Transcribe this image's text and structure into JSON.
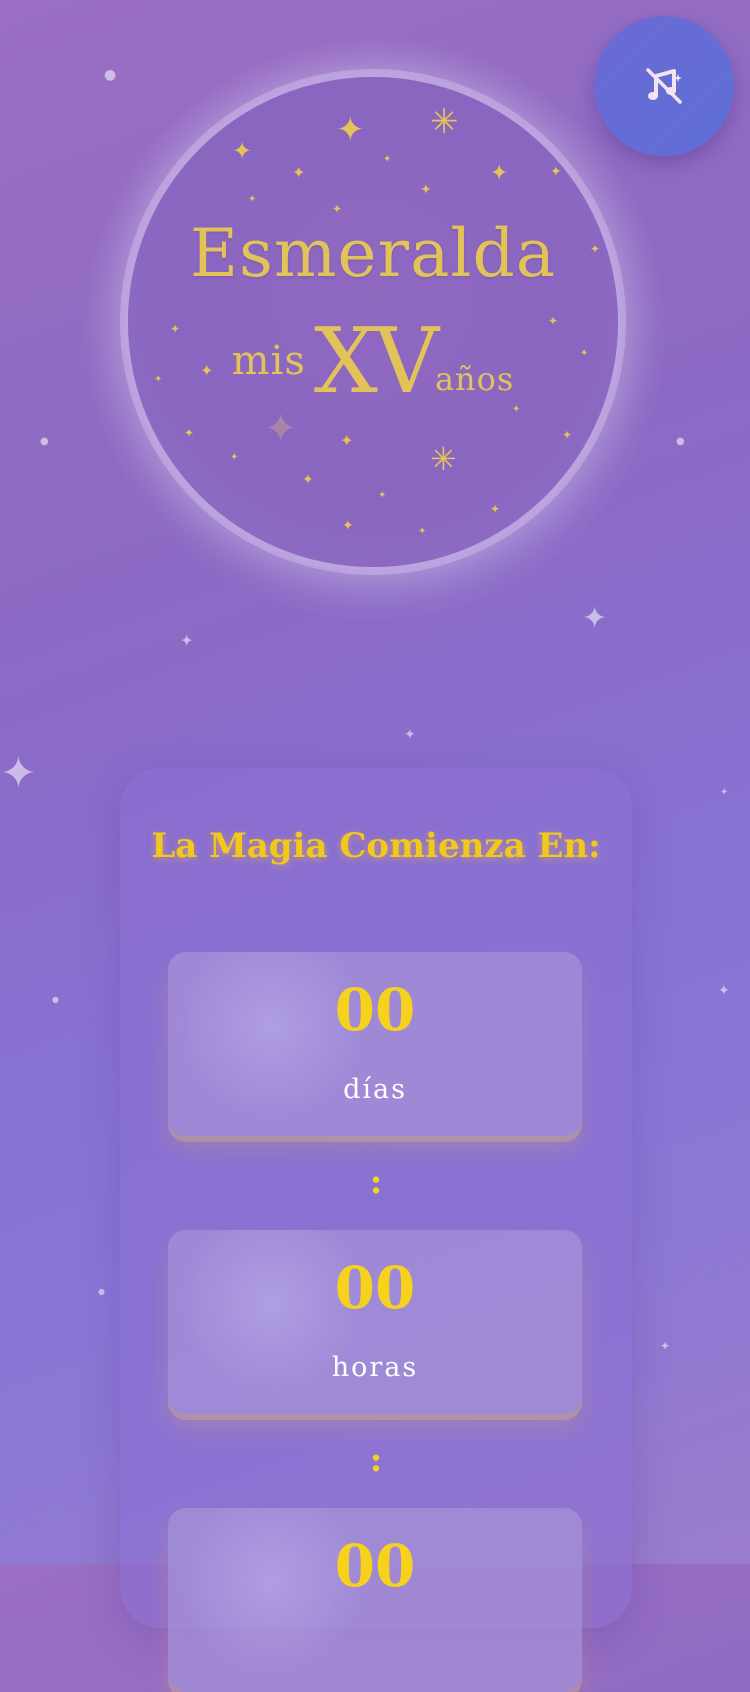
{
  "hero": {
    "name": "Esmeralda",
    "mis": "mis",
    "xv": "XV",
    "anos": "años"
  },
  "music_button": {
    "icon": "music-muted-icon"
  },
  "countdown": {
    "title": "La Magia Comienza En:",
    "days_value": "00",
    "days_label": "días",
    "hours_value": "00",
    "hours_label": "horas",
    "minutes_value": "00",
    "separator": ":"
  },
  "colors": {
    "gold": "#e2c35a",
    "counter_gold": "#f7d21c",
    "background": "#8c6fc8"
  }
}
